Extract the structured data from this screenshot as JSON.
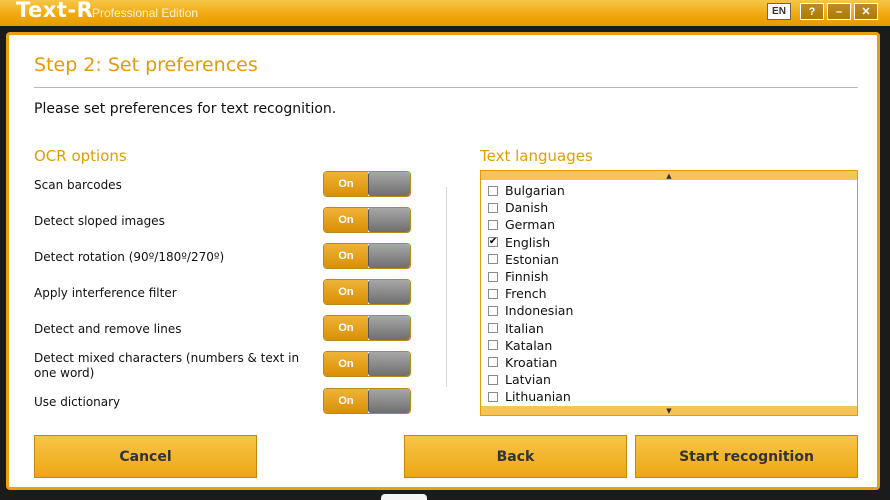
{
  "window": {
    "app_name": "Text-R",
    "edition": "Professional Edition",
    "language_badge": "EN",
    "controls": {
      "help": "?",
      "minimize": "–",
      "close": "✕"
    }
  },
  "page": {
    "step_title": "Step 2: Set preferences",
    "instructions": "Please set preferences for text recognition."
  },
  "ocr": {
    "title": "OCR options",
    "options": [
      {
        "label": "Scan barcodes",
        "state": "On"
      },
      {
        "label": "Detect sloped images",
        "state": "On"
      },
      {
        "label": "Detect rotation (90º/180º/270º)",
        "state": "On"
      },
      {
        "label": "Apply interference filter",
        "state": "On"
      },
      {
        "label": "Detect and remove lines",
        "state": "On"
      },
      {
        "label": "Detect mixed characters (numbers & text in one word)",
        "state": "On"
      },
      {
        "label": "Use dictionary",
        "state": "On"
      }
    ]
  },
  "languages": {
    "title": "Text languages",
    "items": [
      {
        "label": "Bulgarian",
        "checked": false
      },
      {
        "label": "Danish",
        "checked": false
      },
      {
        "label": "German",
        "checked": false
      },
      {
        "label": "English",
        "checked": true
      },
      {
        "label": "Estonian",
        "checked": false
      },
      {
        "label": "Finnish",
        "checked": false
      },
      {
        "label": "French",
        "checked": false
      },
      {
        "label": "Indonesian",
        "checked": false
      },
      {
        "label": "Italian",
        "checked": false
      },
      {
        "label": "Katalan",
        "checked": false
      },
      {
        "label": "Kroatian",
        "checked": false
      },
      {
        "label": "Latvian",
        "checked": false
      },
      {
        "label": "Lithuanian",
        "checked": false
      }
    ]
  },
  "buttons": {
    "cancel": "Cancel",
    "back": "Back",
    "start": "Start recognition"
  },
  "colors": {
    "accent": "#e49b08",
    "titlebar": "#f0a90f",
    "toggle_on": "#e09a10",
    "toggle_off": "#8a8a8a"
  }
}
